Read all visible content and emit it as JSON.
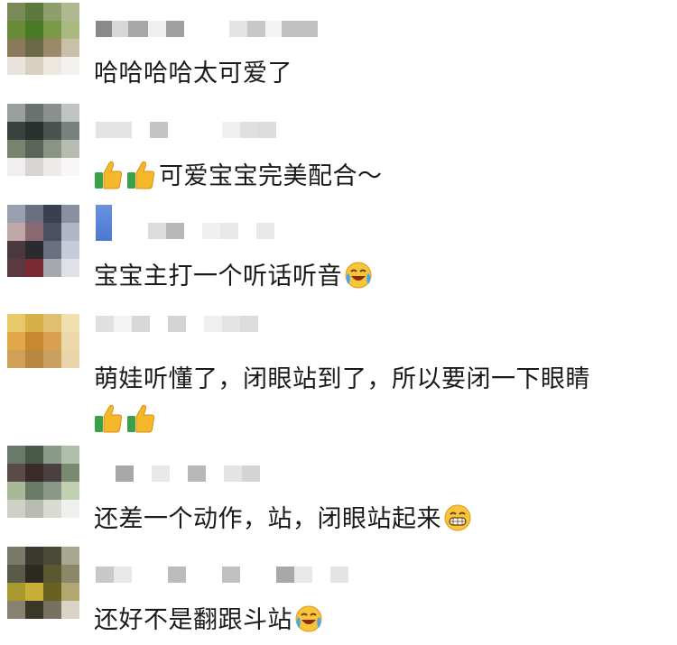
{
  "comments": [
    {
      "text": "哈哈哈哈太可爱了",
      "avatar": [
        "#7a8a5a",
        "#5c7a3c",
        "#8e9e6c",
        "#b0b890",
        "#6a8a3a",
        "#4a7a28",
        "#7a9a4a",
        "#aab882",
        "#8a7a5a",
        "#6a6a48",
        "#9a8a6a",
        "#c8c0a8",
        "#e8e4dc",
        "#d8d0c0",
        "#ece8e0",
        "#f4f2ee"
      ]
    },
    {
      "text": "可爱宝宝完美配合～",
      "avatar": [
        "#9aa0a0",
        "#6a7270",
        "#8a9090",
        "#c0c4c4",
        "#3a4240",
        "#2a302e",
        "#4a5250",
        "#7a8280",
        "#7a8270",
        "#5a6458",
        "#8a9484",
        "#b8bcb0",
        "#f0eeee",
        "#d8d4d4",
        "#eeeaea",
        "#f8f6f6"
      ]
    },
    {
      "text": "宝宝主打一个听话听音",
      "avatar": [
        "#9aa0b0",
        "#6a7080",
        "#3a4050",
        "#8a90a0",
        "#c0a8a8",
        "#8a6a70",
        "#4a5060",
        "#b0b8c8",
        "#4a3a40",
        "#2a2a30",
        "#6a7080",
        "#c8ccd8",
        "#5a3a40",
        "#7a2a30",
        "#a8a8b0",
        "#e0e0e8"
      ]
    },
    {
      "text": "萌娃听懂了，闭眼站到了，所以要闭一下眼睛",
      "avatar": [
        "#e8c868",
        "#d8b048",
        "#e0c070",
        "#f0e0b0",
        "#e0a848",
        "#c88830",
        "#d8a050",
        "#ecd8a8",
        "#d0a058",
        "#b88840",
        "#c8a060",
        "#e8d4a8",
        "#ffffff",
        "#ffffff",
        "#ffffff",
        "#ffffff"
      ]
    },
    {
      "text": "还差一个动作，站，闭眼站起来",
      "avatar": [
        "#6a7a6a",
        "#4a5a4a",
        "#8a9a88",
        "#b0c0a8",
        "#5a4a48",
        "#3a2a2a",
        "#4a4040",
        "#7a8a70",
        "#a8b898",
        "#6a7a68",
        "#8a9888",
        "#c0d0b0",
        "#d0d0c8",
        "#b8bcb0",
        "#d8dcd0",
        "#f0f0ec"
      ]
    },
    {
      "text": "还好不是翻跟斗站",
      "avatar": [
        "#7a7a68",
        "#3a3a30",
        "#4a4a38",
        "#a8a890",
        "#5a5a48",
        "#2a2a20",
        "#5a5830",
        "#8a8868",
        "#a89830",
        "#c8b038",
        "#6a6020",
        "#b0a870",
        "#888070",
        "#3a3628",
        "#787060",
        "#d8d4c8"
      ]
    }
  ]
}
